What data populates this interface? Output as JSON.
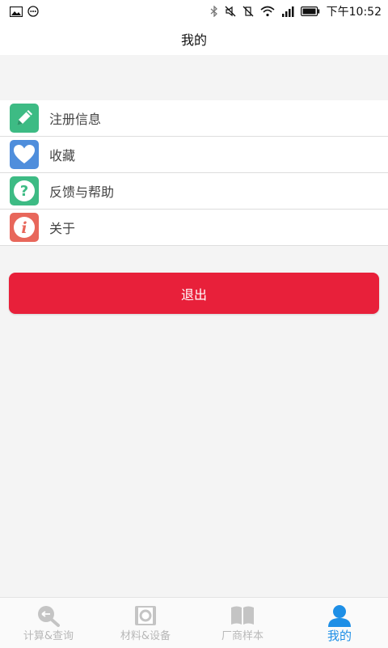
{
  "status_bar": {
    "time": "下午10:52"
  },
  "header": {
    "title": "我的"
  },
  "menu": {
    "items": [
      {
        "label": "注册信息",
        "icon": "pencil-icon",
        "color": "#3dbb84"
      },
      {
        "label": "收藏",
        "icon": "heart-icon",
        "color": "#4f8edc"
      },
      {
        "label": "反馈与帮助",
        "icon": "question-icon",
        "color": "#3dbb84"
      },
      {
        "label": "关于",
        "icon": "info-icon",
        "color": "#e8675b"
      }
    ]
  },
  "logout": {
    "label": "退出",
    "color": "#e8203a"
  },
  "bottom_nav": {
    "items": [
      {
        "label": "计算&查询",
        "icon": "calculator-search-icon",
        "active": false
      },
      {
        "label": "材料&设备",
        "icon": "material-equipment-icon",
        "active": false
      },
      {
        "label": "厂商样本",
        "icon": "book-icon",
        "active": false
      },
      {
        "label": "我的",
        "icon": "user-icon",
        "active": true
      }
    ],
    "active_color": "#1e8fe6",
    "inactive_color": "#b8b8b8"
  }
}
